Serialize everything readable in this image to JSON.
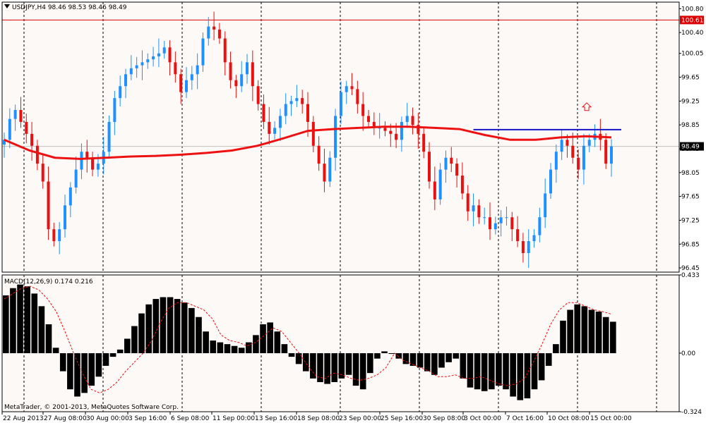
{
  "header": {
    "symbol_line": "USDJPY,H4  98.46 98.53 98.46 98.49",
    "menu_arrow": "triangle-down-icon"
  },
  "macd_label": "MACD(12,26,9) 0.174 0.216",
  "copyright": "MetaTrader, © 2001-2013, MetaQuotes Software Corp.",
  "colors": {
    "background": "#fdf9f7",
    "bull": "#1e90ff",
    "bear": "#e81010",
    "ma": "#ee1111",
    "trend_line": "#1515c8",
    "resistance": "#dd0000",
    "bid_line": "#c0c0c0",
    "histogram": "#000000",
    "signal": "#e81010",
    "arrow": "#e81010"
  },
  "chart_data": [
    {
      "type": "candlestick",
      "symbol": "USDJPY",
      "timeframe": "H4",
      "ohlc_last": {
        "open": 98.46,
        "high": 98.53,
        "low": 98.46,
        "close": 98.49
      },
      "ylim": [
        96.38,
        100.91
      ],
      "y_ticks": [
        "100.80",
        "100.40",
        "100.05",
        "99.65",
        "99.25",
        "98.85",
        "98.45",
        "98.05",
        "97.65",
        "97.25",
        "96.85",
        "96.45"
      ],
      "x_ticks": [
        "22 Aug 2013",
        "27 Aug 08:00",
        "30 Aug 00:00",
        "3 Sep 16:00",
        "6 Sep 08:00",
        "11 Sep 00:00",
        "13 Sep 16:00",
        "18 Sep 08:00",
        "23 Sep 00:00",
        "25 Sep 16:00",
        "30 Sep 08:00",
        "3 Oct 00:00",
        "7 Oct 16:00",
        "10 Oct 08:00",
        "15 Oct 00:00"
      ],
      "current_price": {
        "label": "98.49",
        "value": 98.49
      },
      "resistance": {
        "label": "100.61",
        "value": 100.61
      },
      "closes": [
        98.6,
        98.95,
        99.1,
        98.9,
        98.7,
        98.5,
        98.2,
        97.9,
        97.1,
        96.9,
        97.1,
        97.5,
        97.8,
        98.1,
        98.4,
        98.3,
        98.1,
        98.2,
        98.4,
        98.9,
        99.3,
        99.5,
        99.7,
        99.8,
        99.85,
        99.9,
        99.95,
        100.0,
        100.05,
        100.15,
        99.9,
        99.7,
        99.4,
        99.6,
        99.7,
        99.85,
        100.3,
        100.5,
        100.45,
        100.3,
        99.9,
        99.6,
        99.5,
        99.7,
        99.9,
        99.5,
        99.2,
        98.9,
        98.7,
        98.8,
        99.0,
        99.2,
        99.25,
        99.3,
        99.2,
        98.9,
        98.5,
        98.2,
        97.9,
        98.3,
        99.0,
        99.4,
        99.5,
        99.45,
        99.2,
        99.0,
        98.9,
        98.8,
        98.8,
        98.75,
        98.7,
        98.6,
        98.9,
        99.0,
        98.85,
        98.7,
        98.4,
        97.9,
        97.6,
        98.1,
        98.3,
        98.2,
        98.0,
        97.7,
        97.4,
        97.5,
        97.3,
        97.3,
        97.1,
        97.2,
        97.3,
        97.3,
        97.1,
        96.9,
        96.7,
        96.9,
        97.0,
        97.3,
        97.7,
        98.1,
        98.4,
        98.6,
        98.5,
        98.3,
        98.1,
        98.5,
        98.6,
        98.7,
        98.6,
        98.2,
        98.49
      ],
      "moving_average": [
        98.6,
        98.42,
        98.3,
        98.28,
        98.3,
        98.32,
        98.33,
        98.35,
        98.38,
        98.42,
        98.5,
        98.62,
        98.75,
        98.78,
        98.8,
        98.82,
        98.82,
        98.8,
        98.78,
        98.68,
        98.6,
        98.6,
        98.64,
        98.66,
        98.64
      ],
      "trend_line": {
        "from": 98.77,
        "to": 98.77
      },
      "signal_arrow": {
        "index": 104,
        "value": 99.15
      }
    },
    {
      "type": "bar",
      "name": "MACD(12,26,9)",
      "values_label": "0.174 0.216",
      "ylim": [
        -0.324,
        0.433
      ],
      "y_ticks": [
        "0.433",
        "0.00",
        "-0.324"
      ],
      "histogram": [
        0.32,
        0.36,
        0.38,
        0.37,
        0.33,
        0.26,
        0.16,
        0.03,
        -0.1,
        -0.2,
        -0.24,
        -0.22,
        -0.18,
        -0.13,
        -0.07,
        -0.02,
        0.02,
        0.08,
        0.15,
        0.22,
        0.27,
        0.3,
        0.31,
        0.31,
        0.3,
        0.28,
        0.25,
        0.2,
        0.12,
        0.07,
        0.06,
        0.05,
        0.04,
        0.03,
        0.06,
        0.1,
        0.16,
        0.17,
        0.12,
        0.05,
        -0.02,
        -0.06,
        -0.1,
        -0.14,
        -0.16,
        -0.17,
        -0.16,
        -0.14,
        -0.12,
        -0.18,
        -0.2,
        -0.11,
        -0.03,
        0.01,
        0.0,
        -0.03,
        -0.06,
        -0.07,
        -0.08,
        -0.1,
        -0.12,
        -0.08,
        -0.05,
        -0.03,
        -0.14,
        -0.19,
        -0.2,
        -0.21,
        -0.2,
        -0.18,
        -0.2,
        -0.24,
        -0.26,
        -0.25,
        -0.2,
        -0.15,
        -0.07,
        0.05,
        0.18,
        0.24,
        0.27,
        0.26,
        0.24,
        0.23,
        0.2,
        0.174
      ],
      "signal": [
        0.3,
        0.33,
        0.36,
        0.37,
        0.35,
        0.3,
        0.23,
        0.12,
        0.0,
        -0.11,
        -0.2,
        -0.22,
        -0.2,
        -0.16,
        -0.1,
        -0.05,
        0.0,
        0.07,
        0.17,
        0.25,
        0.28,
        0.28,
        0.26,
        0.24,
        0.19,
        0.1,
        0.07,
        0.06,
        0.04,
        0.06,
        0.1,
        0.14,
        0.12,
        0.06,
        0.0,
        -0.07,
        -0.13,
        -0.14,
        -0.11,
        -0.12,
        -0.14,
        -0.15,
        -0.14,
        -0.12,
        -0.08,
        0.0,
        -0.04,
        -0.06,
        -0.08,
        -0.1,
        -0.13,
        -0.13,
        -0.12,
        -0.14,
        -0.14,
        -0.13,
        -0.15,
        -0.17,
        -0.18,
        -0.17,
        -0.14,
        -0.05,
        0.05,
        0.16,
        0.24,
        0.28,
        0.28,
        0.26,
        0.24,
        0.23,
        0.216
      ]
    }
  ]
}
